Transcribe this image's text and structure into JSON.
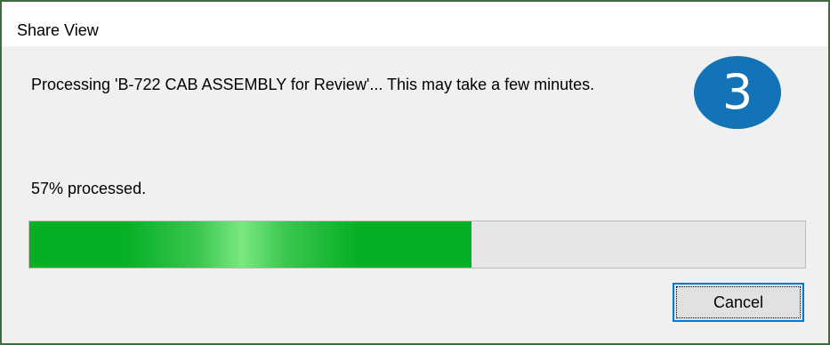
{
  "window": {
    "title": "Share View"
  },
  "dialog": {
    "message": "Processing 'B-722 CAB ASSEMBLY for Review'... This may take a few minutes.",
    "status_text": "57% processed.",
    "progress": {
      "percent": 57,
      "fill_color": "#06b025",
      "highlight_color": "#7ae97f",
      "track_color": "#e6e6e6"
    },
    "cancel_label": "Cancel"
  },
  "badge": {
    "number": "3",
    "color": "#1273b7"
  },
  "colors": {
    "frame_border": "#3b6e3b",
    "focus_border": "#0078d7"
  }
}
